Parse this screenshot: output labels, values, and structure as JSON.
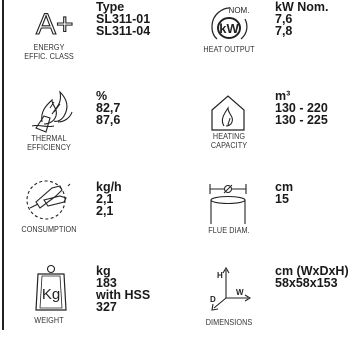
{
  "specs": [
    {
      "caption": [
        "ENERGY",
        "EFFIC. CLASS"
      ],
      "icon_label": "A+",
      "values": [
        "Type",
        "SL311-01",
        "SL311-04"
      ]
    },
    {
      "caption": [
        "HEAT OUTPUT"
      ],
      "icon_label": "kW",
      "icon_tag": "NOM.",
      "values": [
        "kW Nom.",
        "7,6",
        "7,8"
      ]
    },
    {
      "caption": [
        "THERMAL",
        "EFFICIENCY"
      ],
      "values": [
        "%",
        "82,7",
        "87,6"
      ]
    },
    {
      "caption": [
        "HEATING",
        "CAPACITY"
      ],
      "values": [
        "m³",
        "130 - 220",
        "130 - 225"
      ]
    },
    {
      "caption": [
        "CONSUMPTION"
      ],
      "values": [
        "kg/h",
        "2,1",
        "2,1"
      ]
    },
    {
      "caption": [
        "FLUE DIAM."
      ],
      "values": [
        "cm",
        "15"
      ]
    },
    {
      "caption": [
        "WEIGHT"
      ],
      "icon_label": "Kg",
      "values": [
        "kg",
        "183",
        "with HSS",
        "327"
      ]
    },
    {
      "caption": [
        "DIMENSIONS"
      ],
      "icon_letters": [
        "H",
        "W",
        "D"
      ],
      "values": [
        "cm (WxDxH)",
        "58x58x153"
      ]
    }
  ]
}
